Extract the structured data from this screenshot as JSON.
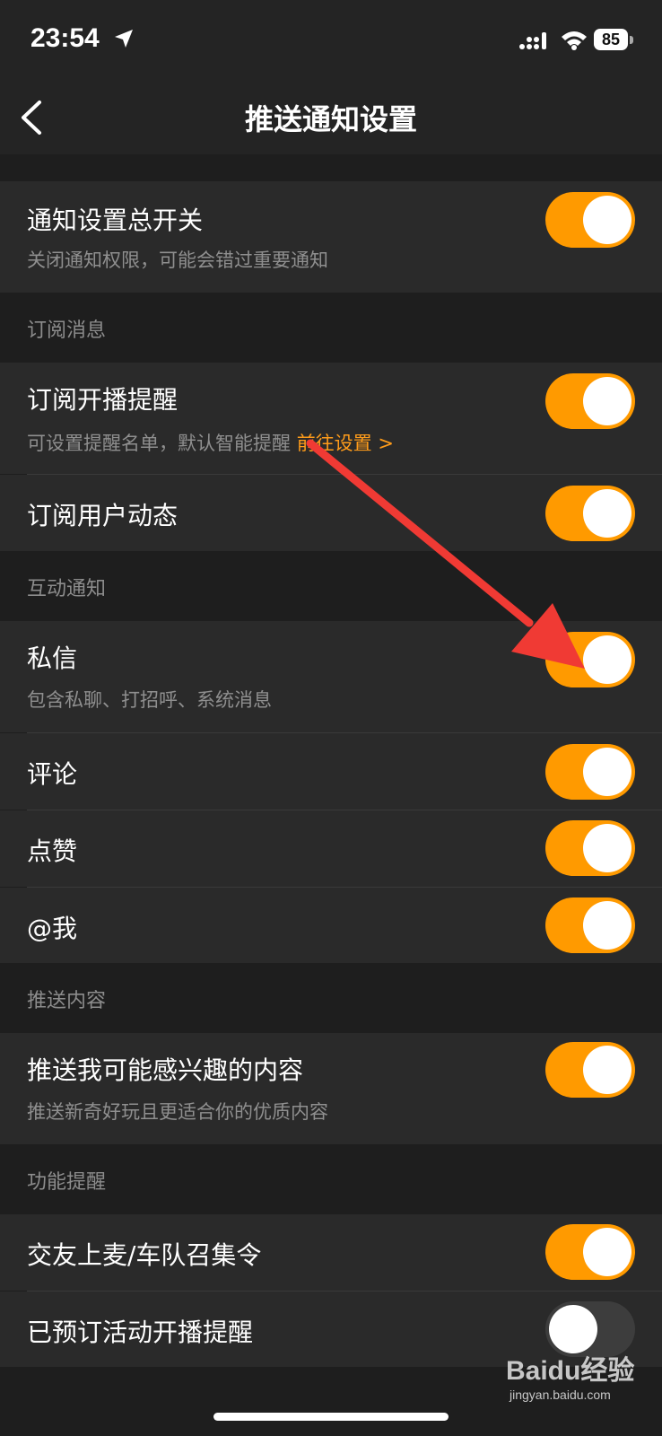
{
  "status_bar": {
    "time": "23:54",
    "battery": "85"
  },
  "nav": {
    "title": "推送通知设置"
  },
  "master": {
    "title": "通知设置总开关",
    "subtitle": "关闭通知权限，可能会错过重要通知",
    "on": true
  },
  "sections": {
    "subscribe": "订阅消息",
    "interact": "互动通知",
    "push_content": "推送内容",
    "feature": "功能提醒"
  },
  "rows": {
    "live_remind": {
      "title": "订阅开播提醒",
      "subtitle": "可设置提醒名单，默认智能提醒",
      "link": "前往设置 >",
      "on": true
    },
    "user_feed": {
      "title": "订阅用户动态",
      "on": true
    },
    "private_msg": {
      "title": "私信",
      "subtitle": "包含私聊、打招呼、系统消息",
      "on": true
    },
    "comment": {
      "title": "评论",
      "on": true
    },
    "like": {
      "title": "点赞",
      "on": true
    },
    "mention": {
      "title": "@我",
      "on": true
    },
    "interest": {
      "title": "推送我可能感兴趣的内容",
      "subtitle": "推送新奇好玩且更适合你的优质内容",
      "on": true
    },
    "mic_call": {
      "title": "交友上麦/车队召集令",
      "on": true
    },
    "event_remind": {
      "title": "已预订活动开播提醒",
      "on": false
    }
  },
  "watermark": {
    "brand": "Baidu经验",
    "domain": "jingyan.baidu.com"
  },
  "colors": {
    "accent": "#ff9a00",
    "annotation_arrow": "#f03a34",
    "background": "#1e1e1e",
    "row": "#2a2a2a"
  }
}
